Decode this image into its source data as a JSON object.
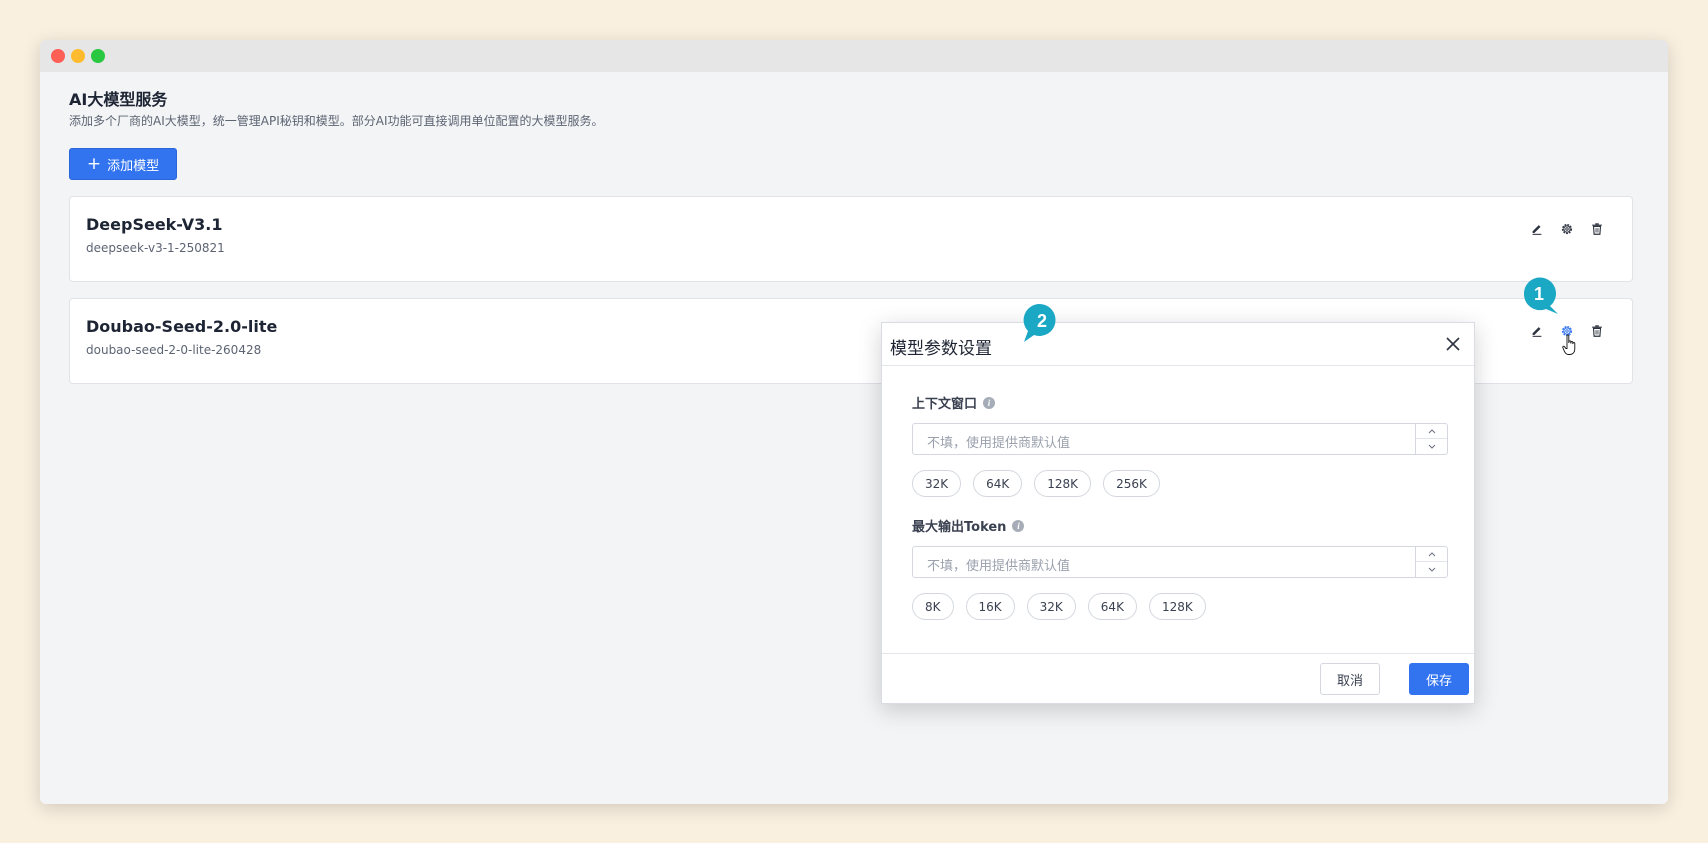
{
  "page": {
    "title": "AI大模型服务",
    "description": "添加多个厂商的AI大模型，统一管理API秘钥和模型。部分AI功能可直接调用单位配置的大模型服务。",
    "add_button_label": "添加模型"
  },
  "models": [
    {
      "name": "DeepSeek-V3.1",
      "model_id": "deepseek-v3-1-250821"
    },
    {
      "name": "Doubao-Seed-2.0-lite",
      "model_id": "doubao-seed-2-0-lite-260428"
    }
  ],
  "annotations": {
    "step1": "1",
    "step2": "2",
    "color": "#1ba8c4"
  },
  "dialog": {
    "title": "模型参数设置",
    "context_window": {
      "label": "上下文窗口",
      "placeholder": "不填，使用提供商默认值",
      "presets": [
        "32K",
        "64K",
        "128K",
        "256K"
      ]
    },
    "max_output": {
      "label": "最大输出Token",
      "placeholder": "不填，使用提供商默认值",
      "presets": [
        "8K",
        "16K",
        "32K",
        "64K",
        "128K"
      ]
    },
    "cancel_label": "取消",
    "save_label": "保存"
  },
  "colors": {
    "primary": "#3273f0",
    "page_bg": "#faf0e0"
  },
  "icons": [
    "edit-icon",
    "gear-icon",
    "trash-icon",
    "close-icon",
    "info-icon",
    "hand-cursor-icon"
  ]
}
